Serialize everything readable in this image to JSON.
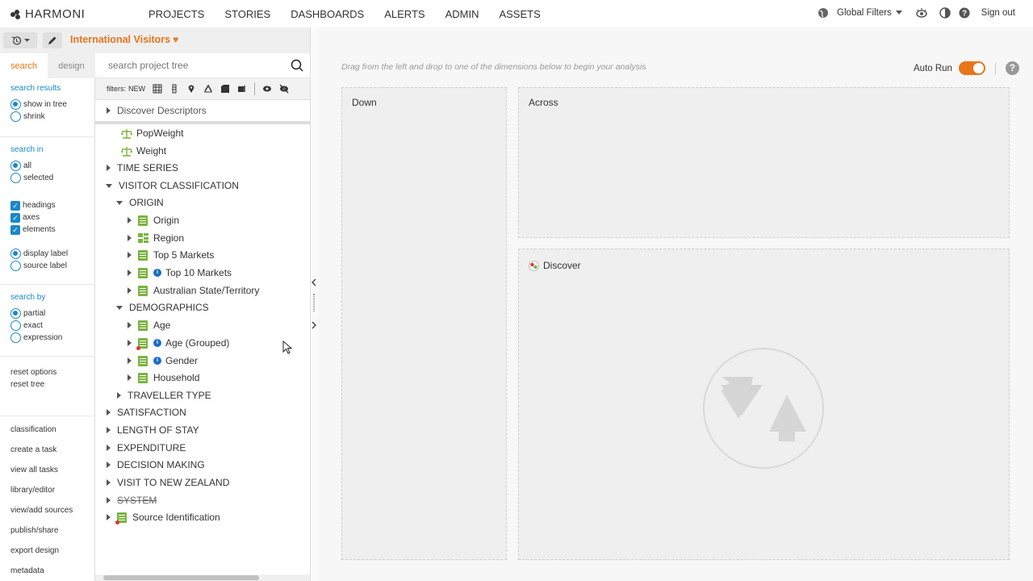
{
  "app": {
    "logo_text": "HARMONI",
    "nav": [
      "PROJECTS",
      "STORIES",
      "DASHBOARDS",
      "ALERTS",
      "ADMIN",
      "ASSETS"
    ],
    "right": {
      "global_filters": "Global Filters",
      "sign_out": "Sign out"
    }
  },
  "project": {
    "title": "International Visitors"
  },
  "left": {
    "tabs": {
      "search": "search",
      "design": "design"
    },
    "search_results": {
      "title": "search results",
      "options": [
        "show in tree",
        "shrink"
      ],
      "selected": "show in tree"
    },
    "search_in": {
      "title": "search in",
      "options": [
        "all",
        "selected"
      ],
      "selected": "all"
    },
    "checks": [
      "headings",
      "axes",
      "elements"
    ],
    "labels": {
      "options": [
        "display label",
        "source label"
      ],
      "selected": "display label"
    },
    "search_by": {
      "title": "search by",
      "options": [
        "partial",
        "exact",
        "expression"
      ],
      "selected": "partial"
    },
    "resets": [
      "reset options",
      "reset tree"
    ],
    "links": [
      "classification",
      "create a task",
      "view all tasks",
      "library/editor",
      "view/add sources",
      "publish/share",
      "export design",
      "metadata"
    ]
  },
  "tree_panel": {
    "search_placeholder": "search project tree",
    "filters_label": "filters:",
    "filters_new": "NEW",
    "nodes": [
      {
        "label": "Discover Descriptors"
      },
      {
        "label": "PopWeight"
      },
      {
        "label": "Weight"
      },
      {
        "label": "TIME SERIES"
      },
      {
        "label": "VISITOR CLASSIFICATION"
      },
      {
        "label": "ORIGIN"
      },
      {
        "label": "Origin"
      },
      {
        "label": "Region"
      },
      {
        "label": "Top 5 Markets"
      },
      {
        "label": "Top 10 Markets"
      },
      {
        "label": "Australian State/Territory"
      },
      {
        "label": "DEMOGRAPHICS"
      },
      {
        "label": "Age"
      },
      {
        "label": "Age (Grouped)"
      },
      {
        "label": "Gender"
      },
      {
        "label": "Household"
      },
      {
        "label": "TRAVELLER TYPE"
      },
      {
        "label": "SATISFACTION"
      },
      {
        "label": "LENGTH OF STAY"
      },
      {
        "label": "EXPENDITURE"
      },
      {
        "label": "DECISION MAKING"
      },
      {
        "label": "VISIT TO NEW ZEALAND"
      },
      {
        "label": "SYSTEM"
      },
      {
        "label": "Source Identification"
      }
    ]
  },
  "main": {
    "hint": "Drag from the left and drop to one of the dimensions below to begin your analysis",
    "auto_run": "Auto Run",
    "auto_run_on": true,
    "zones": {
      "down": "Down",
      "across": "Across",
      "discover": "Discover"
    }
  },
  "colors": {
    "accent": "#e8751a",
    "blue": "#1a88c9",
    "green": "#7ab43f"
  }
}
